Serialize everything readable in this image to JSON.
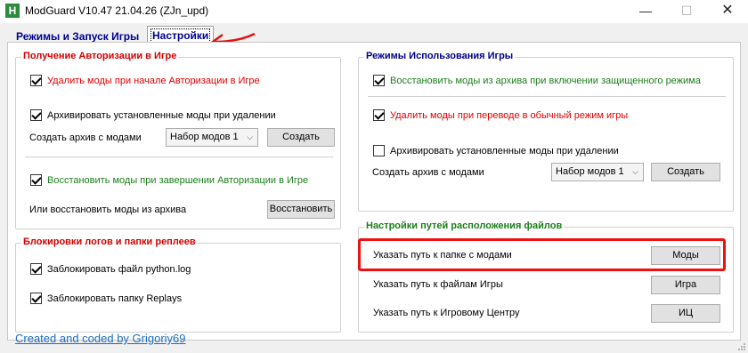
{
  "window": {
    "title": "ModGuard V10.47 21.04.26 (ZJn_upd)",
    "app_icon_letter": "H",
    "minimize_glyph": "—",
    "maximize_glyph": "☐",
    "close_glyph": "✕"
  },
  "tabs": {
    "modes": "Режимы и Запуск Игры",
    "settings": "Настройки"
  },
  "auth_group": {
    "title": "Получение Авторизации в Игре",
    "remove_mods_on_auth": "Удалить моды при начале Авторизации в Игре",
    "archive_on_remove": "Архивировать установленные моды при удалении",
    "create_archive_label": "Создать архив с модами",
    "modset_select": "Набор модов 1",
    "create_button": "Создать",
    "restore_on_auth_end": "Восстановить моды при завершении Авторизации в Игре",
    "or_restore_label": "Или восстановить моды из архива",
    "restore_button": "Восстановить"
  },
  "block_group": {
    "title": "Блокировки логов и папки реплеев",
    "block_python_log": "Заблокировать файл python.log",
    "block_replays": "Заблокировать папку Replays"
  },
  "usage_group": {
    "title": "Режимы Использования Игры",
    "restore_on_protected": "Восстановить моды из архива при включении защищенного режима",
    "remove_on_normal": "Удалить моды при переводе в обычный режим игры",
    "archive_on_remove": "Архивировать установленные моды при удалении",
    "create_archive_label": "Создать архив с модами",
    "modset_select": "Набор модов 1",
    "create_button": "Создать"
  },
  "paths_group": {
    "title": "Настройки путей расположения файлов",
    "mods_path_label": "Указать путь к папке с модами",
    "mods_button": "Моды",
    "game_path_label": "Указать путь к файлам Игры",
    "game_button": "Игра",
    "gamecenter_path_label": "Указать путь к Игровому Центру",
    "gamecenter_button": "ИЦ"
  },
  "footer": {
    "link": "Created and coded by Grigoriy69"
  },
  "colors": {
    "group_title_red": "#d40000",
    "group_title_blue": "#00008b",
    "group_title_green": "#1a7f1a",
    "option_red": "#e00000",
    "option_green": "#1a7f1a",
    "annotation_red": "#e11111",
    "link_blue": "#1f6fbf"
  },
  "checkboxes": {
    "remove_mods_on_auth": true,
    "archive_on_remove_left": true,
    "restore_on_auth_end": true,
    "block_python_log": true,
    "block_replays": true,
    "restore_on_protected": true,
    "remove_on_normal": true,
    "archive_on_remove_right": false
  }
}
